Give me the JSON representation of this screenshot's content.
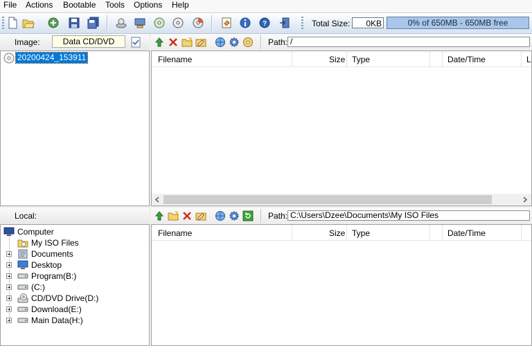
{
  "menu": [
    "File",
    "Actions",
    "Bootable",
    "Tools",
    "Options",
    "Help"
  ],
  "toolbar": {
    "total_size_label": "Total Size:",
    "total_size_value": "0KB",
    "capacity_text": "0% of 650MB - 650MB free"
  },
  "image_pane": {
    "label": "Image:",
    "image_type": "Data CD/DVD",
    "path_label": "Path:",
    "path_value": "/",
    "root_node": "20200424_153911",
    "columns": [
      "Filename",
      "Size",
      "Type",
      "Date/Time",
      "L"
    ]
  },
  "local_pane": {
    "label": "Local:",
    "path_label": "Path:",
    "path_value": "C:\\Users\\Dzee\\Documents\\My ISO Files",
    "columns": [
      "Filename",
      "Size",
      "Type",
      "Date/Time"
    ],
    "tree": {
      "root": "Computer",
      "items": [
        "My ISO Files",
        "Documents",
        "Desktop",
        "Program(B:)",
        "(C:)",
        "CD/DVD Drive(D:)",
        "Download(E:)",
        "Main Data(H:)"
      ]
    }
  },
  "colors": {
    "accent": "#0078d7",
    "capacity_bar": "#a8c7eb",
    "toolbar_bg": "#e4ecf6"
  }
}
